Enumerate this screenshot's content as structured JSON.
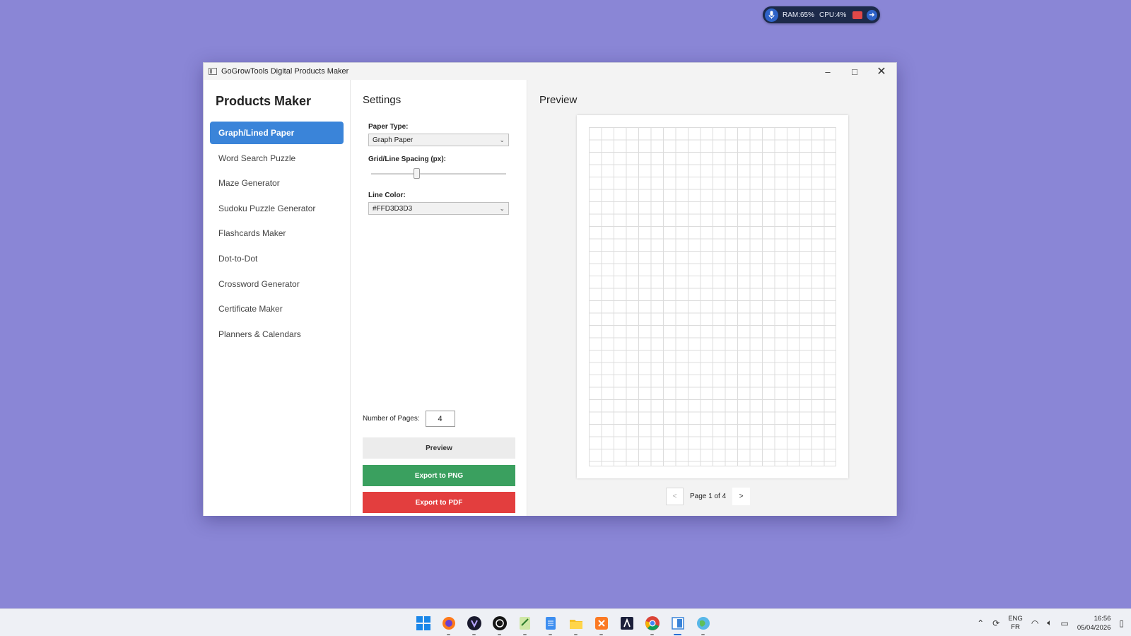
{
  "sysmon": {
    "ram": "RAM:65%",
    "cpu": "CPU:4%"
  },
  "window": {
    "title": "GoGrowTools Digital Products Maker",
    "minimize": "–",
    "maximize": "□",
    "close": "✕"
  },
  "sidebar": {
    "title": "Products Maker",
    "items": [
      {
        "label": "Graph/Lined Paper",
        "active": true
      },
      {
        "label": "Word Search Puzzle"
      },
      {
        "label": "Maze Generator"
      },
      {
        "label": "Sudoku Puzzle Generator"
      },
      {
        "label": "Flashcards Maker"
      },
      {
        "label": "Dot-to-Dot"
      },
      {
        "label": "Crossword Generator"
      },
      {
        "label": "Certificate Maker"
      },
      {
        "label": "Planners & Calendars"
      }
    ]
  },
  "settings": {
    "title": "Settings",
    "paper_type_label": "Paper Type:",
    "paper_type_value": "Graph Paper",
    "spacing_label": "Grid/Line Spacing (px):",
    "spacing_level": 0.33,
    "line_color_label": "Line Color:",
    "line_color_value": "#FFD3D3D3",
    "pages_label": "Number of Pages:",
    "pages_value": "4",
    "preview_button": "Preview",
    "export_png_button": "Export to PNG",
    "export_pdf_button": "Export to PDF"
  },
  "preview": {
    "title": "Preview",
    "page_indicator": "Page 1 of 4",
    "prev_label": "<",
    "next_label": ">"
  },
  "taskbar": {
    "apps": [
      "windows-start",
      "firefox",
      "app-dark-1",
      "app-dark-2",
      "notepad-plus",
      "notepad",
      "file-explorer",
      "xampp",
      "terminal-a",
      "chrome",
      "digital-products-maker",
      "maps-globe"
    ],
    "lang_top": "ENG",
    "lang_bottom": "FR",
    "time": "16:56",
    "date": "05/04/2026"
  },
  "colors": {
    "desktop": "#8a86d6",
    "accent": "#3a84d9",
    "png_button": "#3aa05f",
    "pdf_button": "#e33e3e",
    "grid_line": "#dcdcdc"
  }
}
